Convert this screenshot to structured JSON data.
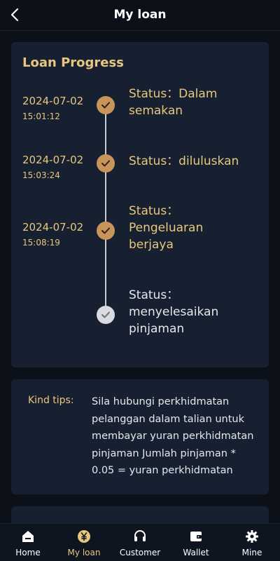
{
  "header": {
    "title": "My loan",
    "back_icon": "chevron-left-icon"
  },
  "progress": {
    "title": "Loan Progress",
    "steps": [
      {
        "date": "2024-07-02",
        "time": "15:01:12",
        "status_lines": [
          "Status：Dalam",
          "semakan"
        ],
        "state": "done"
      },
      {
        "date": "2024-07-02",
        "time": "15:03:24",
        "status_lines": [
          "Status：diluluskan"
        ],
        "state": "done"
      },
      {
        "date": "2024-07-02",
        "time": "15:08:19",
        "status_lines": [
          "Status：",
          "Pengeluaran",
          "berjaya"
        ],
        "state": "done"
      },
      {
        "date": "",
        "time": "",
        "status_lines": [
          "Status：",
          "menyelesaikan",
          "pinjaman"
        ],
        "state": "pending"
      }
    ]
  },
  "tips": {
    "label": "Kind tips:",
    "lines": [
      "Sila hubungi perkhidmatan",
      "pelanggan dalam talian untuk",
      "membayar yuran perkhidmatan",
      "pinjaman Jumlah pinjaman *",
      "0.05 = yuran perkhidmatan"
    ]
  },
  "nav": {
    "items": [
      {
        "label": "Home",
        "icon": "home-icon"
      },
      {
        "label": "My loan",
        "icon": "yen-coin-icon",
        "active": true
      },
      {
        "label": "Customer",
        "icon": "headset-icon"
      },
      {
        "label": "Wallet",
        "icon": "wallet-icon"
      },
      {
        "label": "Mine",
        "icon": "gear-icon"
      }
    ]
  },
  "colors": {
    "accent": "#e9c67e",
    "node_done": "#c7955a",
    "node_pending": "#d9dbe0",
    "card_bg": "#172030",
    "page_bg": "#0b1019"
  }
}
